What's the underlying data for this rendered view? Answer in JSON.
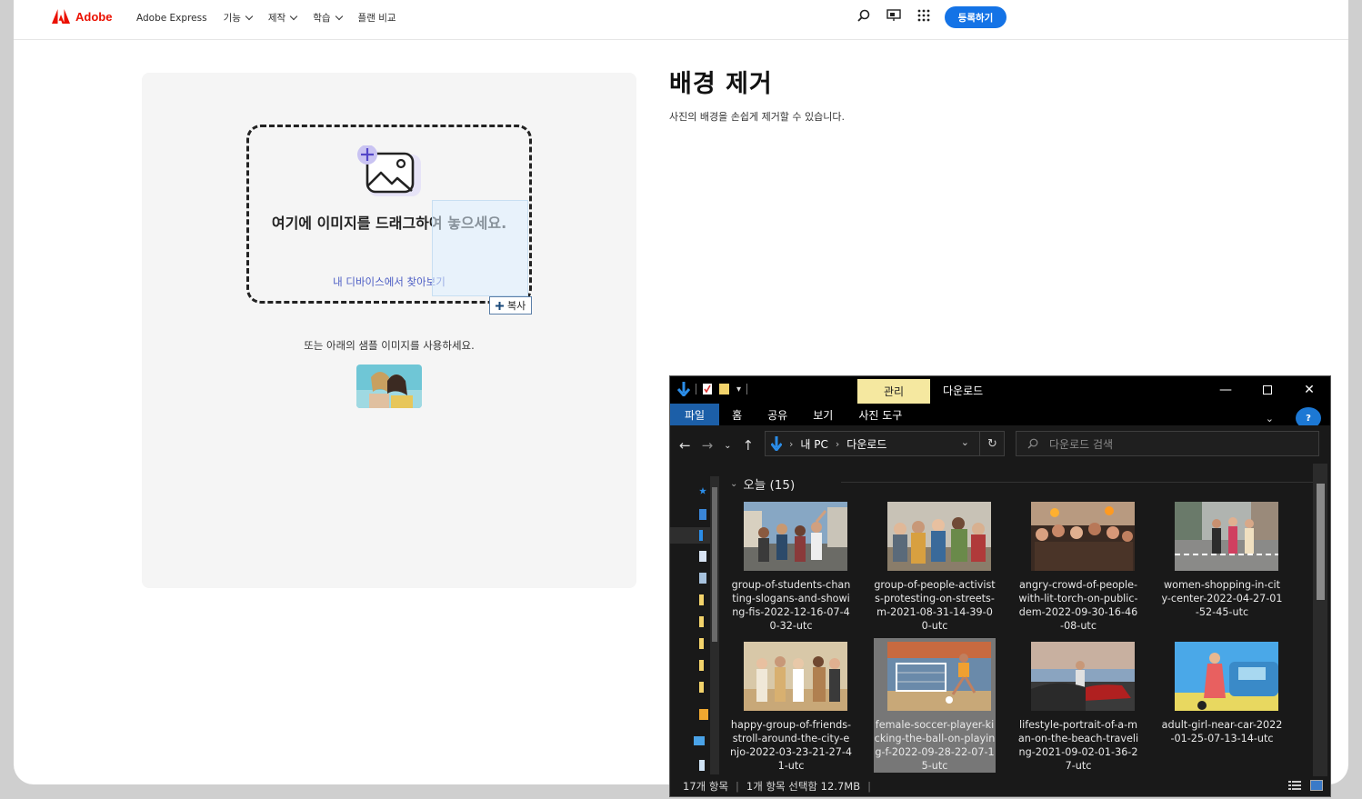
{
  "nav": {
    "brand": "Adobe",
    "links": [
      {
        "label": "Adobe Express",
        "has_menu": false
      },
      {
        "label": "기능",
        "has_menu": true
      },
      {
        "label": "제작",
        "has_menu": true
      },
      {
        "label": "학습",
        "has_menu": true
      },
      {
        "label": "플랜 비교",
        "has_menu": false
      }
    ],
    "signup": "등록하기"
  },
  "upload": {
    "drop_text": "여기에 이미지를 드래그하여 놓으세요.",
    "browse_link": "내 디바이스에서 찾아보기",
    "copy_badge": "복사",
    "sample_text": "또는 아래의 샘플 이미지를 사용하세요."
  },
  "hero": {
    "title": "배경 제거",
    "description": "사진의 배경을 손쉽게 제거할 수 있습니다."
  },
  "explorer": {
    "manage_tab": "관리",
    "window_title": "다운로드",
    "ribbon_tabs": [
      "파일",
      "홈",
      "공유",
      "보기",
      "사진 도구"
    ],
    "breadcrumb": [
      "내 PC",
      "다운로드"
    ],
    "search_placeholder": "다운로드 검색",
    "group_header": "오늘 (15)",
    "files": [
      {
        "name": "group-of-students-chanting-slogans-and-showing-fis-2022-12-16-07-40-32-utc",
        "selected": false
      },
      {
        "name": "group-of-people-activists-protesting-on-streets-m-2021-08-31-14-39-00-utc",
        "selected": false
      },
      {
        "name": "angry-crowd-of-people-with-lit-torch-on-public-dem-2022-09-30-16-46-08-utc",
        "selected": false
      },
      {
        "name": "women-shopping-in-city-center-2022-04-27-01-52-45-utc",
        "selected": false
      },
      {
        "name": "happy-group-of-friends-stroll-around-the-city-enjo-2022-03-23-21-27-41-utc",
        "selected": false
      },
      {
        "name": "female-soccer-player-kicking-the-ball-on-playing-f-2022-09-28-22-07-15-utc",
        "selected": true
      },
      {
        "name": "lifestyle-portrait-of-a-man-on-the-beach-traveling-2021-09-02-01-36-27-utc",
        "selected": false
      },
      {
        "name": "adult-girl-near-car-2022-01-25-07-13-14-utc",
        "selected": false
      }
    ],
    "status_items": "17개 항목",
    "status_selected": "1개 항목 선택함 12.7MB"
  },
  "colors": {
    "adobe_red": "#eb1000",
    "primary_blue": "#1473e6",
    "link_purple": "#4b5cc4",
    "manage_tab": "#f5e8a0",
    "ribbon_active": "#1c5fa8"
  }
}
